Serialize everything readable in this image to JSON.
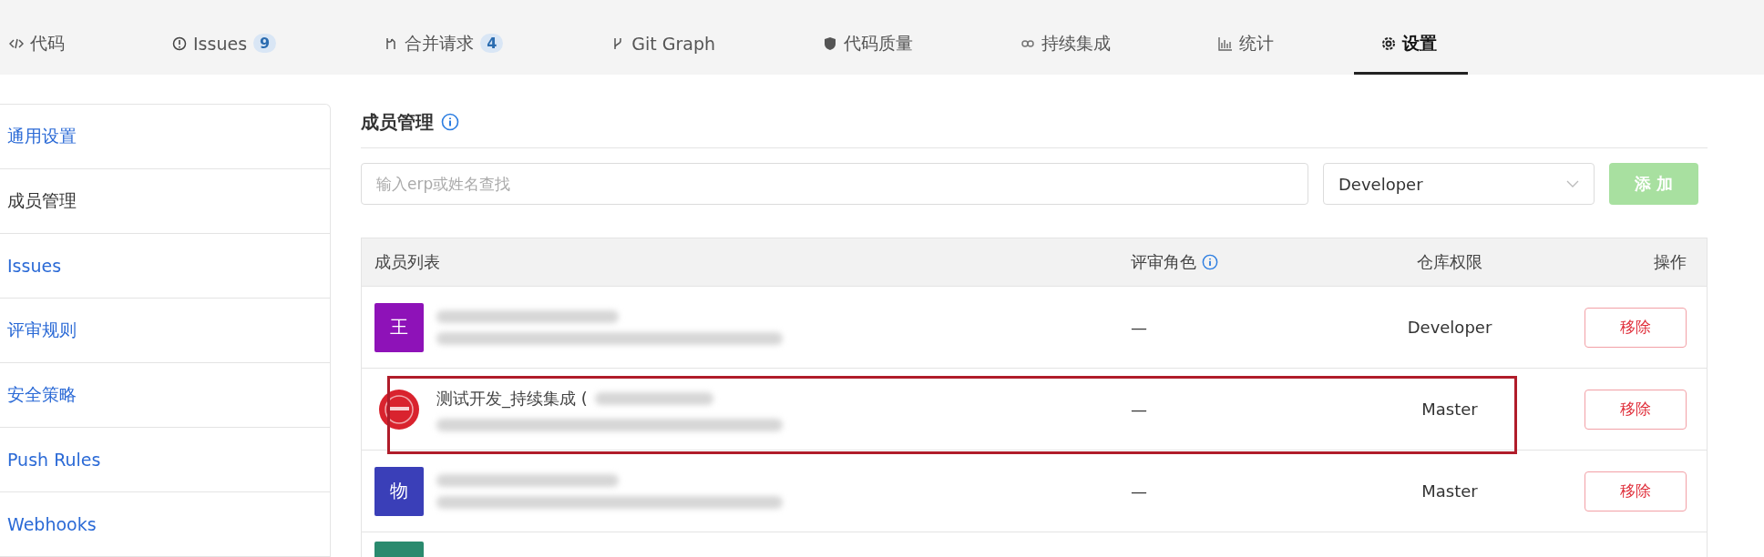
{
  "tabs": [
    {
      "kind": "code",
      "label": "代码",
      "selected": false
    },
    {
      "kind": "alert",
      "label": "Issues",
      "count": "9",
      "selected": false
    },
    {
      "kind": "merge",
      "label": "合并请求",
      "count": "4",
      "selected": false
    },
    {
      "kind": "branch",
      "label": "Git Graph",
      "selected": false
    },
    {
      "kind": "shield",
      "label": "代码质量",
      "selected": false
    },
    {
      "kind": "ci",
      "label": "持续集成",
      "selected": false
    },
    {
      "kind": "chart",
      "label": "统计",
      "selected": false
    },
    {
      "kind": "gear",
      "label": "设置",
      "selected": true
    }
  ],
  "sidebar": {
    "items": [
      {
        "label": "通用设置",
        "selected": false
      },
      {
        "label": "成员管理",
        "selected": true
      },
      {
        "label": "Issues",
        "selected": false
      },
      {
        "label": "评审规则",
        "selected": false
      },
      {
        "label": "安全策略",
        "selected": false
      },
      {
        "label": "Push Rules",
        "selected": false
      },
      {
        "label": "Webhooks",
        "selected": false
      }
    ]
  },
  "section": {
    "title": "成员管理",
    "search": {
      "placeholder": "输入erp或姓名查找"
    },
    "role_select": {
      "value": "Developer"
    },
    "add_button": {
      "label": "添 加",
      "disabled": true
    }
  },
  "table": {
    "columns": [
      "成员列表",
      "评审角色",
      "仓库权限",
      "操作"
    ],
    "rows": [
      {
        "kind": "member",
        "avatar": {
          "kind": "letter",
          "text": "王",
          "color": "#8e12b8"
        },
        "review_role": "—",
        "permission": "Developer",
        "action": "移除",
        "highlighted": false
      },
      {
        "kind": "member",
        "avatar": {
          "kind": "logo",
          "color": "#d9232e"
        },
        "name": "测试开发_持续集成 (",
        "review_role": "—",
        "permission": "Master",
        "action": "移除",
        "highlighted": true
      },
      {
        "kind": "member",
        "avatar": {
          "kind": "letter",
          "text": "物",
          "color": "#3a3fb8"
        },
        "review_role": "—",
        "permission": "Master",
        "action": "移除",
        "highlighted": false
      },
      {
        "avatar": {
          "kind": "partial",
          "color": "#2a8a6e"
        },
        "kind": "partial",
        "highlighted": false
      }
    ]
  }
}
